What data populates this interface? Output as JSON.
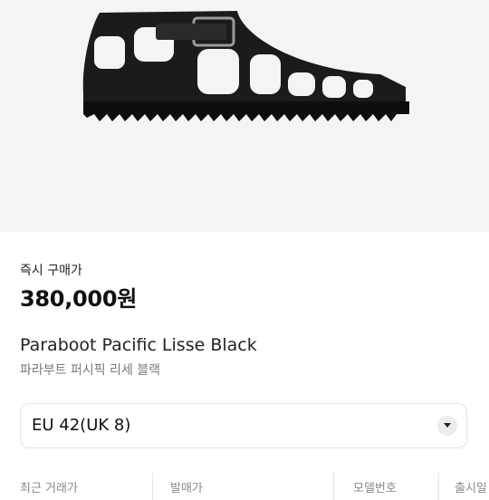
{
  "product": {
    "image_icon": "sandal-image",
    "instant_buy_label": "즉시 구매가",
    "price": "380,000원",
    "name_en": "Paraboot Pacific Lisse Black",
    "name_ko": "파라부트 퍼시픽 리세 블랙"
  },
  "size_selector": {
    "value": "EU 42(UK 8)",
    "icon": "chevron-down-icon"
  },
  "info": {
    "columns": [
      "최근 거래가",
      "발매가",
      "모델번호",
      "출시일"
    ]
  },
  "colors": {
    "background": "#ffffff",
    "hero_bg": "#f4f4f4",
    "text": "#111111",
    "muted": "#7a7a7a"
  }
}
